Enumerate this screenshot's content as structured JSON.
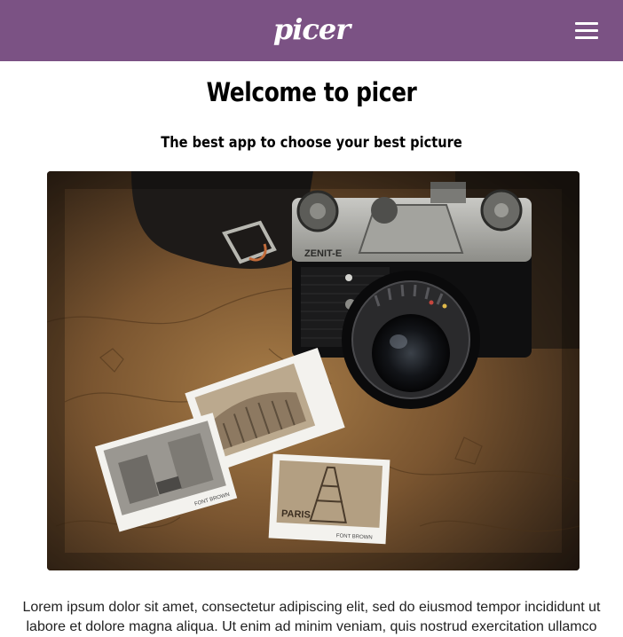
{
  "header": {
    "logo_text": "picer",
    "menu_icon": "hamburger-menu-icon",
    "background_color": "#7b5284"
  },
  "main": {
    "title": "Welcome to picer",
    "subtitle": "The best app to choose your best picture",
    "hero_image": {
      "camera_label": "ZENIT-E",
      "photo_label_paris": "PARIS",
      "photo_caption": "FONT BROWN"
    },
    "paragraph": "Lorem ipsum dolor sit amet, consectetur adipiscing elit, sed do eiusmod tempor incididunt ut labore et dolore magna aliqua. Ut enim ad minim veniam, quis nostrud exercitation ullamco"
  }
}
